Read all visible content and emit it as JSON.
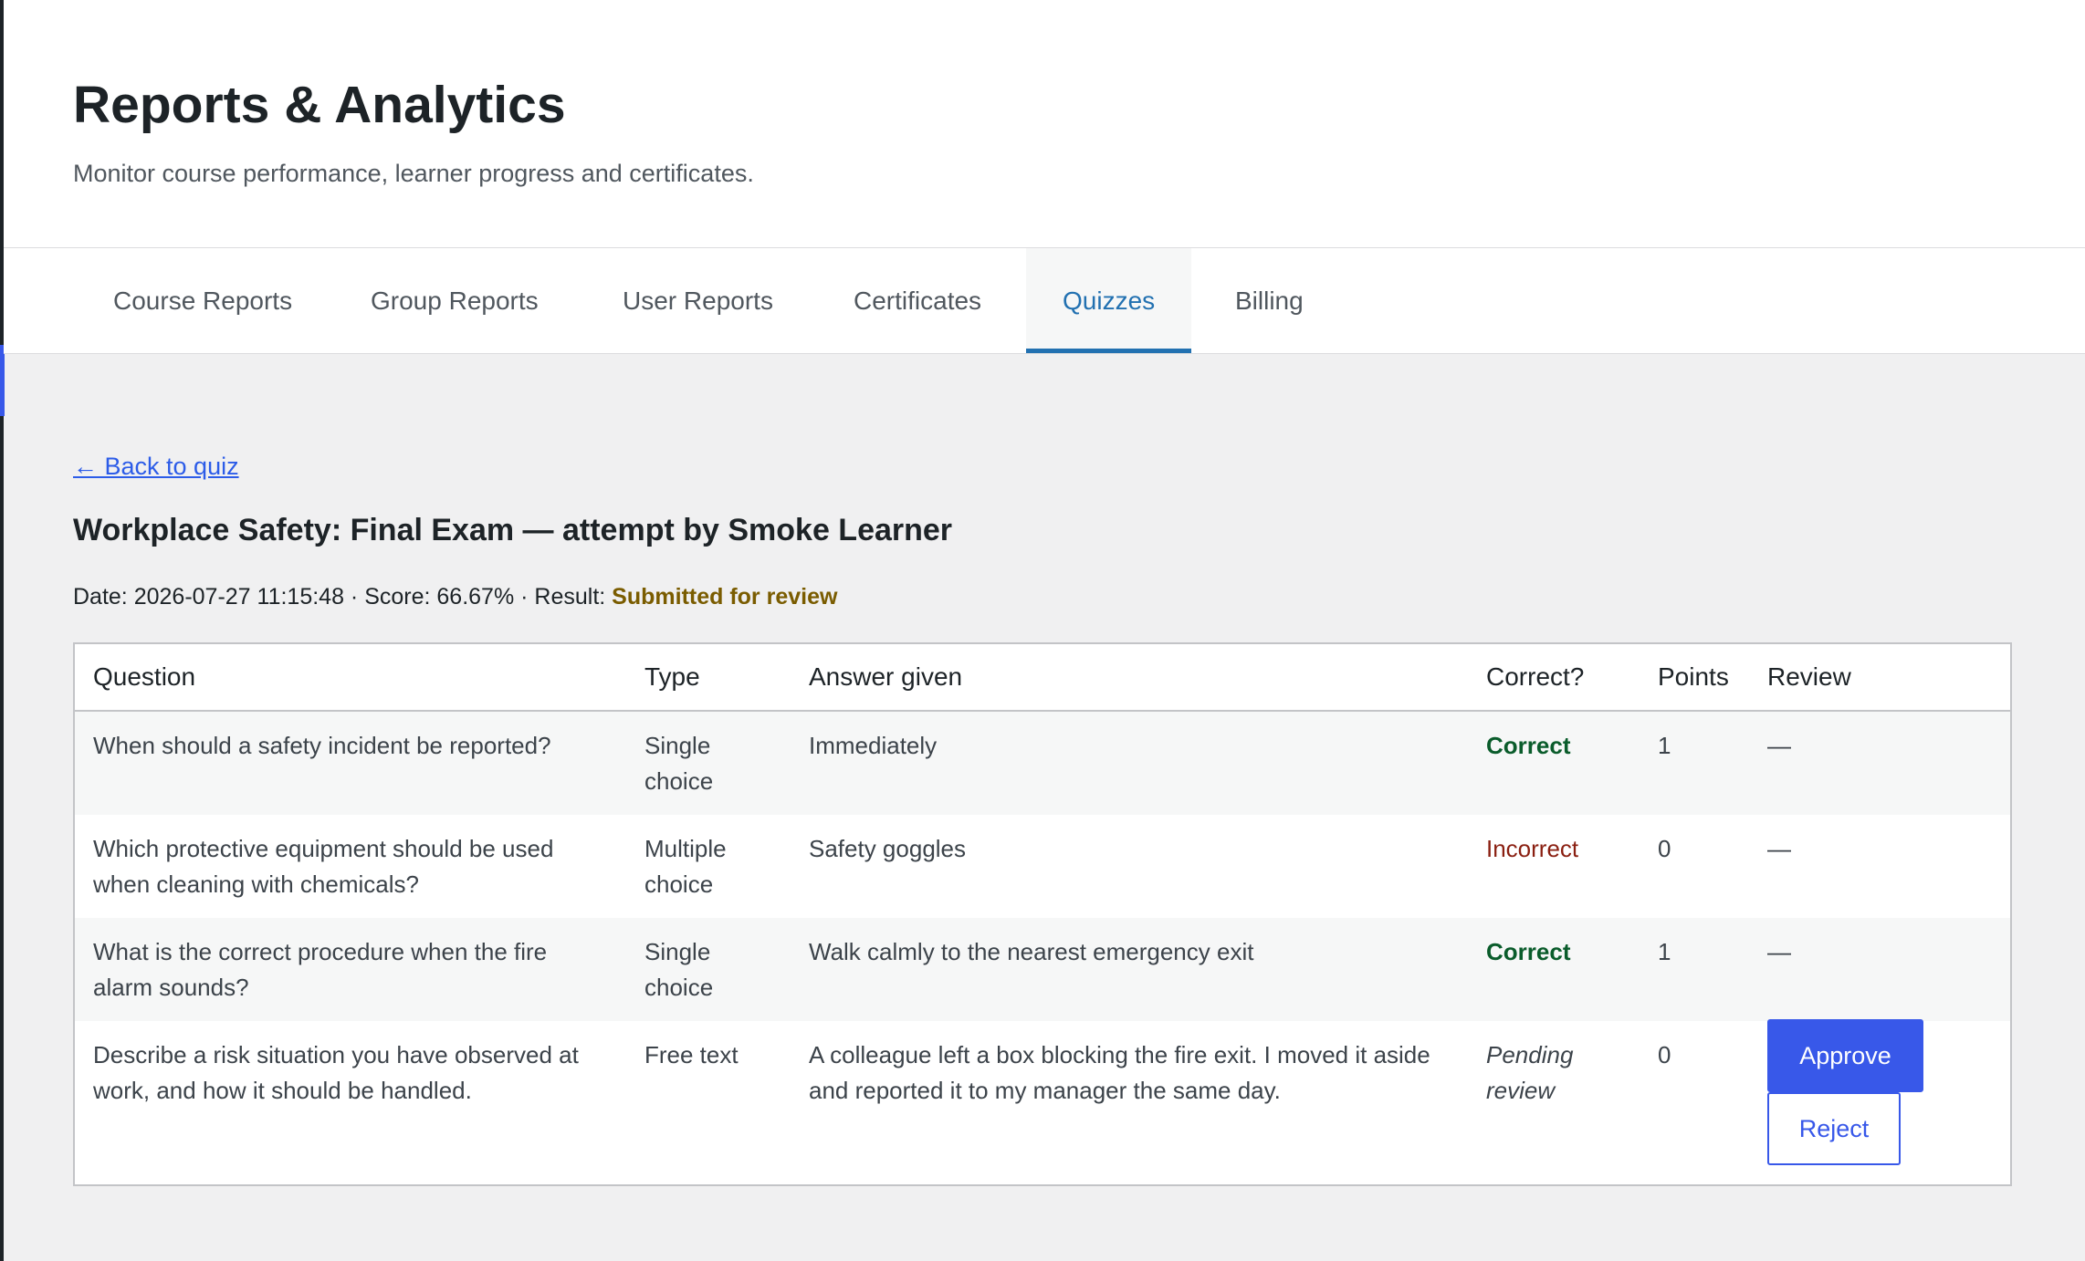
{
  "header": {
    "title": "Reports & Analytics",
    "subtitle": "Monitor course performance, learner progress and certificates."
  },
  "tabs": [
    {
      "label": "Course Reports"
    },
    {
      "label": "Group Reports"
    },
    {
      "label": "User Reports"
    },
    {
      "label": "Certificates"
    },
    {
      "label": "Quizzes",
      "active": true
    },
    {
      "label": "Billing"
    }
  ],
  "back_link": "← Back to quiz",
  "attempt": {
    "title": "Workplace Safety: Final Exam — attempt by Smoke Learner",
    "meta_prefix": "Date: 2026-07-27 11:15:48 · Score: 66.67% · Result: ",
    "result": "Submitted for review"
  },
  "table": {
    "columns": [
      "Question",
      "Type",
      "Answer given",
      "Correct?",
      "Points",
      "Review"
    ],
    "rows": [
      {
        "question": "When should a safety incident be reported?",
        "type": "Single choice",
        "answer": "Immediately",
        "correct": "Correct",
        "points": "1",
        "review": "—"
      },
      {
        "question": "Which protective equipment should be used when cleaning with chemicals?",
        "type": "Multiple choice",
        "answer": "Safety goggles",
        "correct": "Incorrect",
        "points": "0",
        "review": "—"
      },
      {
        "question": "What is the correct procedure when the fire alarm sounds?",
        "type": "Single choice",
        "answer": "Walk calmly to the nearest emergency exit",
        "correct": "Correct",
        "points": "1",
        "review": "—"
      },
      {
        "question": "Describe a risk situation you have observed at work, and how it should be handled.",
        "type": "Free text",
        "answer": "A colleague left a box blocking the fire exit. I moved it aside and reported it to my manager the same day.",
        "correct": "Pending review",
        "points": "0",
        "approve_label": "Approve",
        "reject_label": "Reject"
      }
    ]
  },
  "colors": {
    "accent": "#2271b1",
    "button": "#3858e9",
    "link": "#2c5ce8",
    "correct": "#0a5c2b",
    "incorrect": "#8a1f11",
    "result": "#7a5c00"
  }
}
